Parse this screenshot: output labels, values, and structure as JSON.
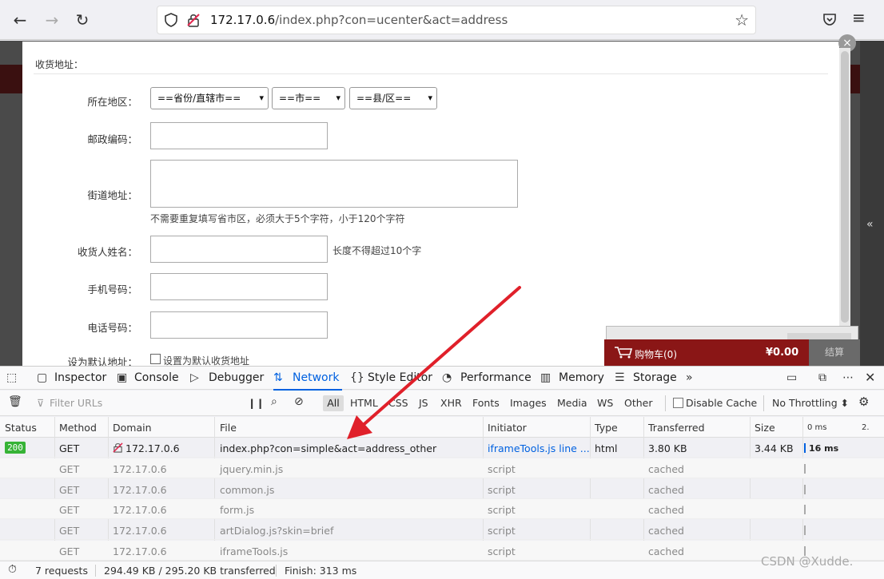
{
  "browser": {
    "url_host": "172.17.0.6",
    "url_path": "/index.php?con=ucenter&act=address"
  },
  "dialog": {
    "title": "收货地址：",
    "fields": {
      "region_label": "所在地区：",
      "province_select": "==省份/直辖市==",
      "city_select": "==市==",
      "county_select": "==县/区==",
      "zip_label": "邮政编码：",
      "street_label": "街道地址：",
      "street_hint": "不需要重复填写省市区，必须大于5个字符，小于120个字符",
      "name_label": "收货人姓名：",
      "name_hint": "长度不得超过10个字",
      "mobile_label": "手机号码：",
      "phone_label": "电话号码：",
      "default_label": "设为默认地址：",
      "default_checkbox": "设置为默认收货地址"
    }
  },
  "cart": {
    "label": "购物车(0)",
    "amount": "¥0.00",
    "checkout": "结算"
  },
  "devtools": {
    "tabs": [
      "Inspector",
      "Console",
      "Debugger",
      "Network",
      "Style Editor",
      "Performance",
      "Memory",
      "Storage"
    ],
    "active_tab": "Network",
    "filter_placeholder": "Filter URLs",
    "type_filters": [
      "All",
      "HTML",
      "CSS",
      "JS",
      "XHR",
      "Fonts",
      "Images",
      "Media",
      "WS",
      "Other"
    ],
    "disable_cache": "Disable Cache",
    "throttling": "No Throttling ⬍",
    "columns": [
      "Status",
      "Method",
      "Domain",
      "File",
      "Initiator",
      "Type",
      "Transferred",
      "Size",
      "0 ms",
      "2."
    ],
    "rows": [
      {
        "status": "200",
        "method": "GET",
        "domain": "172.17.0.6",
        "file": "index.php?con=simple&act=address_other",
        "initiator": "iframeTools.js line ...",
        "type": "html",
        "transferred": "3.80 KB",
        "size": "3.44 KB",
        "time": "16 ms"
      },
      {
        "status": "",
        "method": "GET",
        "domain": "172.17.0.6",
        "file": "jquery.min.js",
        "initiator": "script",
        "type": "",
        "transferred": "cached",
        "size": "",
        "time": ""
      },
      {
        "status": "",
        "method": "GET",
        "domain": "172.17.0.6",
        "file": "common.js",
        "initiator": "script",
        "type": "",
        "transferred": "cached",
        "size": "",
        "time": ""
      },
      {
        "status": "",
        "method": "GET",
        "domain": "172.17.0.6",
        "file": "form.js",
        "initiator": "script",
        "type": "",
        "transferred": "cached",
        "size": "",
        "time": ""
      },
      {
        "status": "",
        "method": "GET",
        "domain": "172.17.0.6",
        "file": "artDialog.js?skin=brief",
        "initiator": "script",
        "type": "",
        "transferred": "cached",
        "size": "",
        "time": ""
      },
      {
        "status": "",
        "method": "GET",
        "domain": "172.17.0.6",
        "file": "iframeTools.js",
        "initiator": "script",
        "type": "",
        "transferred": "cached",
        "size": "",
        "time": ""
      }
    ],
    "summary": {
      "requests": "7 requests",
      "transferred": "294.49 KB / 295.20 KB transferred",
      "finish": "Finish: 313 ms"
    }
  },
  "watermark": "CSDN @Xudde."
}
